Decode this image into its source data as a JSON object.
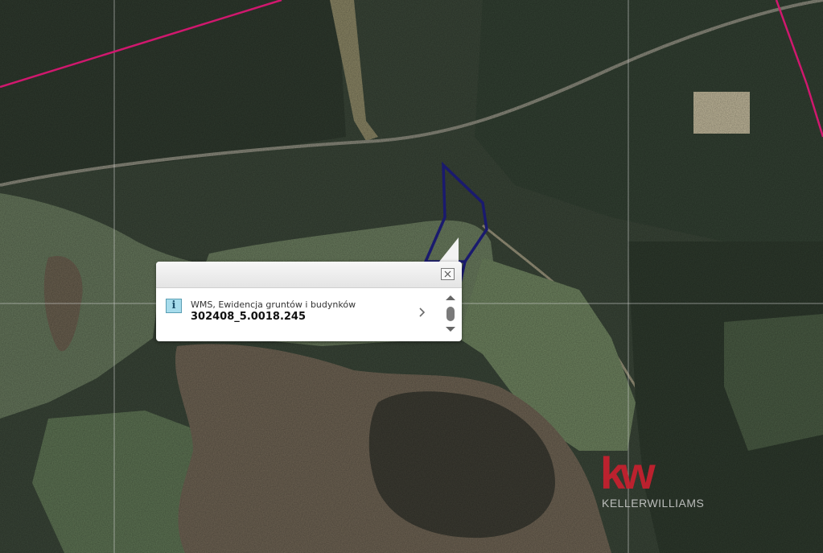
{
  "popup": {
    "layer_name": "WMS, Ewidencja gruntów i budynków",
    "parcel_id": "302408_5.0018.245"
  },
  "logo": {
    "mark": "kw",
    "name": "KELLERWILLIAMS",
    "brand_color": "#c8202f"
  },
  "map": {
    "view": "aerial-orthophoto",
    "parcel_outline_color": "#1a1a6e",
    "boundary_line_color": "#d0186e",
    "grid_line_color": "#d8d8d8"
  },
  "icons": [
    "info-icon",
    "close-icon",
    "chevron-right-icon",
    "scroll-up-icon",
    "scroll-down-icon",
    "scroll-thumb"
  ]
}
